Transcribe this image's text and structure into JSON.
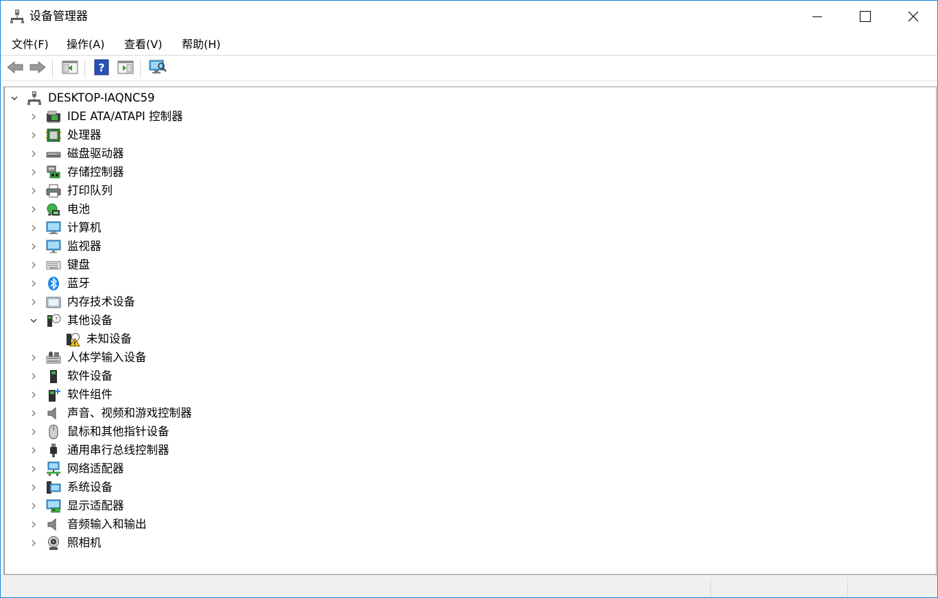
{
  "window": {
    "title": "设备管理器"
  },
  "menu": [
    {
      "label": "文件(F)"
    },
    {
      "label": "操作(A)"
    },
    {
      "label": "查看(V)"
    },
    {
      "label": "帮助(H)"
    }
  ],
  "toolbar": {
    "buttons": [
      {
        "name": "back-button",
        "icon": "arrow-left-icon"
      },
      {
        "name": "forward-button",
        "icon": "arrow-right-icon"
      },
      {
        "name": "show-hide-console-tree-button",
        "icon": "console-tree-icon"
      },
      {
        "name": "help-button",
        "icon": "help-icon"
      },
      {
        "name": "show-action-pane-button",
        "icon": "action-pane-icon"
      },
      {
        "name": "scan-hardware-button",
        "icon": "scan-monitor-icon"
      }
    ]
  },
  "tree": {
    "root": {
      "label": "DESKTOP-IAQNC59",
      "expanded": true
    },
    "items": [
      {
        "label": "IDE ATA/ATAPI 控制器",
        "icon": "ide-controller-icon"
      },
      {
        "label": "处理器",
        "icon": "processor-icon"
      },
      {
        "label": "磁盘驱动器",
        "icon": "disk-drive-icon"
      },
      {
        "label": "存储控制器",
        "icon": "storage-controller-icon"
      },
      {
        "label": "打印队列",
        "icon": "printer-icon"
      },
      {
        "label": "电池",
        "icon": "battery-icon"
      },
      {
        "label": "计算机",
        "icon": "computer-icon"
      },
      {
        "label": "监视器",
        "icon": "monitor-icon"
      },
      {
        "label": "键盘",
        "icon": "keyboard-icon"
      },
      {
        "label": "蓝牙",
        "icon": "bluetooth-icon"
      },
      {
        "label": "内存技术设备",
        "icon": "memory-device-icon"
      },
      {
        "label": "其他设备",
        "icon": "other-devices-icon",
        "expanded": true
      },
      {
        "label": "未知设备",
        "icon": "unknown-device-warning-icon",
        "child": true
      },
      {
        "label": "人体学输入设备",
        "icon": "hid-icon"
      },
      {
        "label": "软件设备",
        "icon": "software-device-icon"
      },
      {
        "label": "软件组件",
        "icon": "software-component-icon"
      },
      {
        "label": "声音、视频和游戏控制器",
        "icon": "speaker-icon"
      },
      {
        "label": "鼠标和其他指针设备",
        "icon": "mouse-icon"
      },
      {
        "label": "通用串行总线控制器",
        "icon": "usb-icon"
      },
      {
        "label": "网络适配器",
        "icon": "network-adapter-icon"
      },
      {
        "label": "系统设备",
        "icon": "system-device-icon"
      },
      {
        "label": "显示适配器",
        "icon": "display-adapter-icon"
      },
      {
        "label": "音频输入和输出",
        "icon": "audio-io-icon"
      },
      {
        "label": "照相机",
        "icon": "camera-icon"
      }
    ]
  }
}
